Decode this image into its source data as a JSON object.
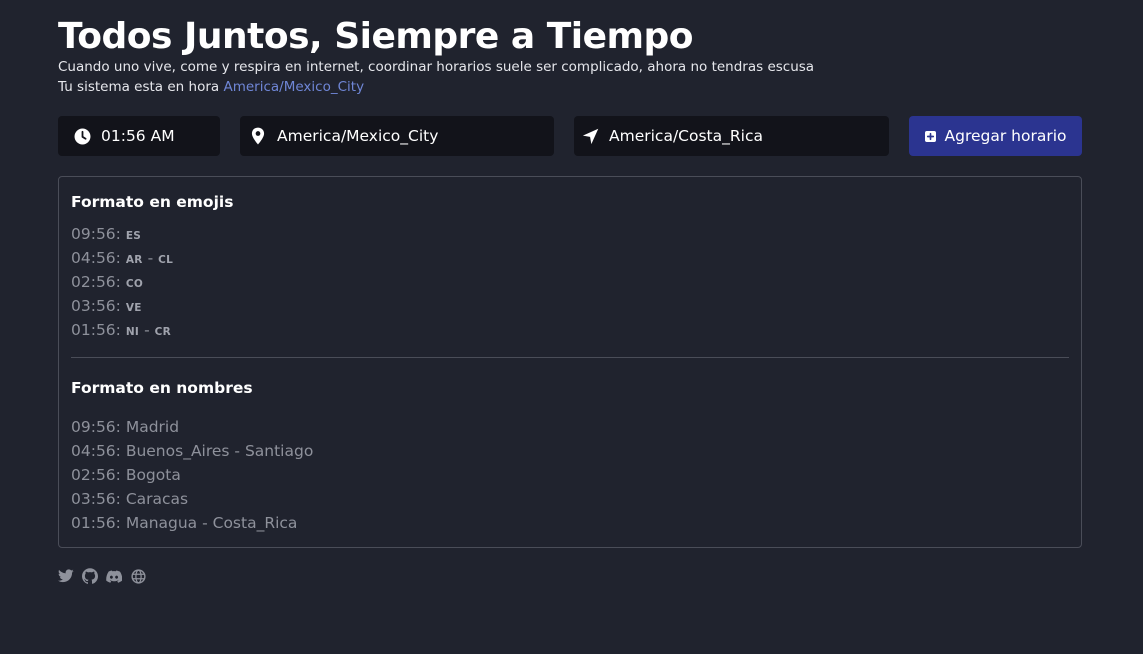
{
  "header": {
    "title": "Todos Juntos, Siempre a Tiempo",
    "subtitle": "Cuando uno vive, come y respira en internet, coordinar horarios suele ser complicado, ahora no tendras escusa",
    "system_tz_prefix": "Tu sistema esta en hora",
    "system_tz": "America/Mexico_City"
  },
  "controls": {
    "time": "01:56 AM",
    "time_icon": "clock-icon",
    "from_tz": "America/Mexico_City",
    "from_icon": "map-pin-icon",
    "to_tz": "America/Costa_Rica",
    "to_icon": "location-arrow-icon",
    "add_button": "Agregar horario",
    "add_icon": "plus-square-icon"
  },
  "emoji_section": {
    "title": "Formato en emojis",
    "rows": [
      {
        "time": "09:56:",
        "flags": [
          "ES"
        ]
      },
      {
        "time": "04:56:",
        "flags": [
          "AR",
          "CL"
        ]
      },
      {
        "time": "02:56:",
        "flags": [
          "CO"
        ]
      },
      {
        "time": "03:56:",
        "flags": [
          "VE"
        ]
      },
      {
        "time": "01:56:",
        "flags": [
          "NI",
          "CR"
        ]
      }
    ]
  },
  "names_section": {
    "title": "Formato en nombres",
    "rows": [
      "09:56: Madrid",
      "04:56: Buenos_Aires - Santiago",
      "02:56: Bogota",
      "03:56: Caracas",
      "01:56: Managua - Costa_Rica"
    ]
  },
  "separator": "-",
  "footer": {
    "icons": [
      "twitter-icon",
      "github-icon",
      "discord-icon",
      "globe-icon"
    ]
  },
  "colors": {
    "background": "#20232e",
    "input_bg": "#12131a",
    "button_bg": "#2b3490",
    "link": "#6f86d6",
    "muted_text": "#8e919b",
    "border": "#4a4d58"
  }
}
